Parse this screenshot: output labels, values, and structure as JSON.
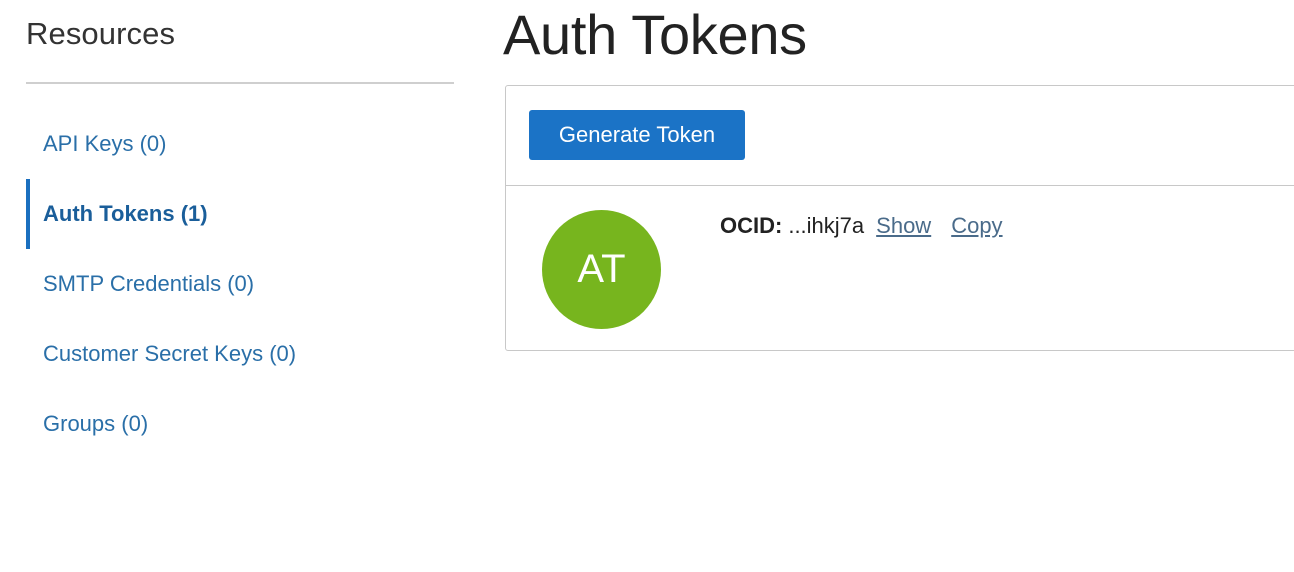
{
  "sidebar": {
    "heading": "Resources",
    "items": [
      {
        "label": "API Keys (0)"
      },
      {
        "label": "Auth Tokens (1)"
      },
      {
        "label": "SMTP Credentials (0)"
      },
      {
        "label": "Customer Secret Keys (0)"
      },
      {
        "label": "Groups (0)"
      }
    ],
    "active_index": 1
  },
  "main": {
    "title": "Auth Tokens",
    "generate_button_label": "Generate Token",
    "token": {
      "avatar_initials": "AT",
      "avatar_color": "#77b51e",
      "ocid_label": "OCID:",
      "ocid_value": "...ihkj7a",
      "show_label": "Show",
      "copy_label": "Copy"
    }
  },
  "colors": {
    "accent": "#1b73c6",
    "link": "#2a6fa8"
  }
}
